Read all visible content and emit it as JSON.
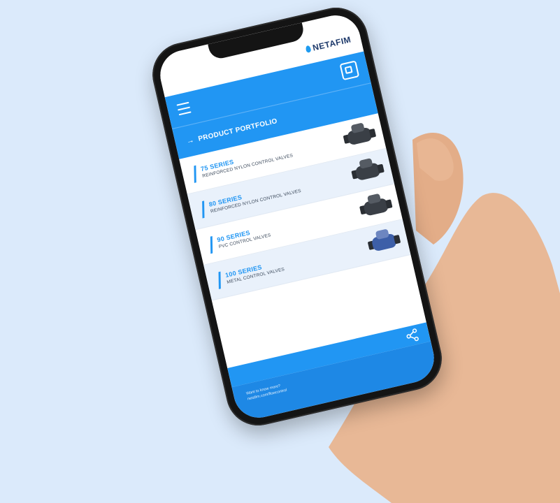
{
  "app": {
    "brand": "NETAFIM",
    "section_title": "PRODUCT PORTFOLIO"
  },
  "products": [
    {
      "name": "75 SERIES",
      "description": "REINFORCED NYLON CONTROL VALVES"
    },
    {
      "name": "80 SERIES",
      "description": "REINFORCED NYLON CONTROL VALVES"
    },
    {
      "name": "90 SERIES",
      "description": "PVC CONTROL VALVES"
    },
    {
      "name": "100 SERIES",
      "description": "METAL CONTROL VALVES"
    }
  ],
  "footer": {
    "line1": "Want to know more?",
    "line2": "netafim.com/flowcontrol"
  },
  "icons": {
    "menu": "hamburger-menu-icon",
    "catalog": "catalog-icon",
    "share": "share-icon",
    "arrow": "arrow-right-icon"
  },
  "colors": {
    "background": "#dbeafb",
    "primary": "#2196f3",
    "accent_dark": "#1e3a6b"
  }
}
